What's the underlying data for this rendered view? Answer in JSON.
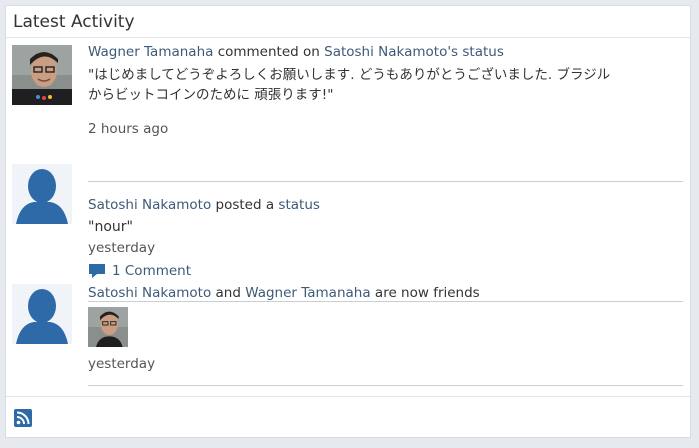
{
  "panel": {
    "title": "Latest Activity"
  },
  "activities": [
    {
      "actor": "Wagner Tamanaha",
      "verb": "commented on",
      "target": "Satoshi Nakamoto's status",
      "quote": "\"はじめましてどうぞよろしくお願いします. どうもありがとうございました. ブラジルからビットコインのために 頑張ります!\"",
      "quote_line1": "\"はじめましてどうぞよろしくお願いします. どうもありがとうございました. ブラジル",
      "quote_line2": "からビットコインのために 頑張ります!\"",
      "time": "2 hours ago"
    },
    {
      "actor": "Satoshi Nakamoto",
      "verb": "posted a",
      "target": "status",
      "quote": "\"nour\"",
      "time": "yesterday",
      "comments": "1 Comment"
    },
    {
      "actor": "Satoshi Nakamoto",
      "verb": "and",
      "target": "Wagner Tamanaha",
      "suffix": "are now friends",
      "time": "yesterday"
    }
  ],
  "icons": {
    "comment": "speech-bubble-icon",
    "rss": "rss-feed-icon",
    "default_avatar": "person-silhouette-icon"
  },
  "colors": {
    "link": "#3d5a78",
    "avatar_blue": "#2d6aa7",
    "rss": "#2d6aa7",
    "background": "#e6e9ee"
  }
}
